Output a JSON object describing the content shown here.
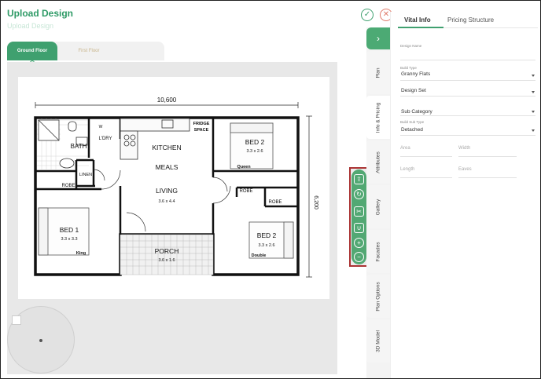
{
  "header": {
    "title": "Upload Design",
    "subtitle_ghost": "Upload Design"
  },
  "floors": {
    "tabs": [
      {
        "label": "Ground Floor"
      },
      {
        "label": "First Floor"
      }
    ]
  },
  "plan": {
    "dimension_width": "10,600",
    "dimension_height": "6,200",
    "rooms": {
      "bath": "BATH",
      "ldry": "L'DRY",
      "kitchen": "KITCHEN",
      "fridge": [
        "FRIDGE",
        "SPACE"
      ],
      "meals": "MEALS",
      "living": "LIVING",
      "living_size": "3.6 x 4.4",
      "bed2_top": "BED 2",
      "bed2_top_size": "3.3 x 2.6",
      "bed2_top_bed": "Queen",
      "linen": "LINEN",
      "robe_left": "ROBE",
      "robe_mid": "ROBE",
      "robe_right": "ROBE",
      "bed1": "BED 1",
      "bed1_size": "3.3 x 3.3",
      "bed1_bed": "King",
      "porch": "PORCH",
      "porch_size": "3.6 x 1.6",
      "bed2_bottom": "BED 2",
      "bed2_bottom_size": "3.3 x 2.6",
      "bed2_bottom_bed": "Double",
      "w_label": "W"
    }
  },
  "actions": {
    "confirm_icon": "✓",
    "close_icon": "✕"
  },
  "side_tabs": {
    "expand_icon": "›",
    "items": [
      {
        "label": "Plan"
      },
      {
        "label": "Info & Pricing"
      },
      {
        "label": "Attributes"
      },
      {
        "label": "Gallery"
      },
      {
        "label": "Facades"
      },
      {
        "label": "Plan Options"
      },
      {
        "label": "3D Model"
      }
    ]
  },
  "panel": {
    "tabs": [
      {
        "label": "Vital Info"
      },
      {
        "label": "Pricing Structure"
      }
    ],
    "design_name_label": "Design Name",
    "build_type_label": "Build Type",
    "build_type_value": "Granny Flats",
    "design_set_value": "Design Set",
    "sub_category_value": "Sub Category",
    "build_sub_type_label": "Build Sub Type",
    "build_sub_type_value": "Detached",
    "area_placeholder": "Area",
    "width_placeholder": "Width",
    "length_placeholder": "Length",
    "eaves_placeholder": "Eaves"
  },
  "toolbar": {
    "tools": [
      {
        "name": "export-icon",
        "glyph": "⇪"
      },
      {
        "name": "rotate-icon",
        "glyph": "↻"
      },
      {
        "name": "scissors-icon",
        "glyph": "✂"
      },
      {
        "name": "magnet-icon",
        "glyph": "∪"
      },
      {
        "name": "zoom-in-icon",
        "glyph": "+"
      },
      {
        "name": "zoom-out-icon",
        "glyph": "−"
      }
    ]
  },
  "colors": {
    "accent": "#3fa06f",
    "danger": "#e07a6a",
    "highlight_border": "#a33333"
  }
}
